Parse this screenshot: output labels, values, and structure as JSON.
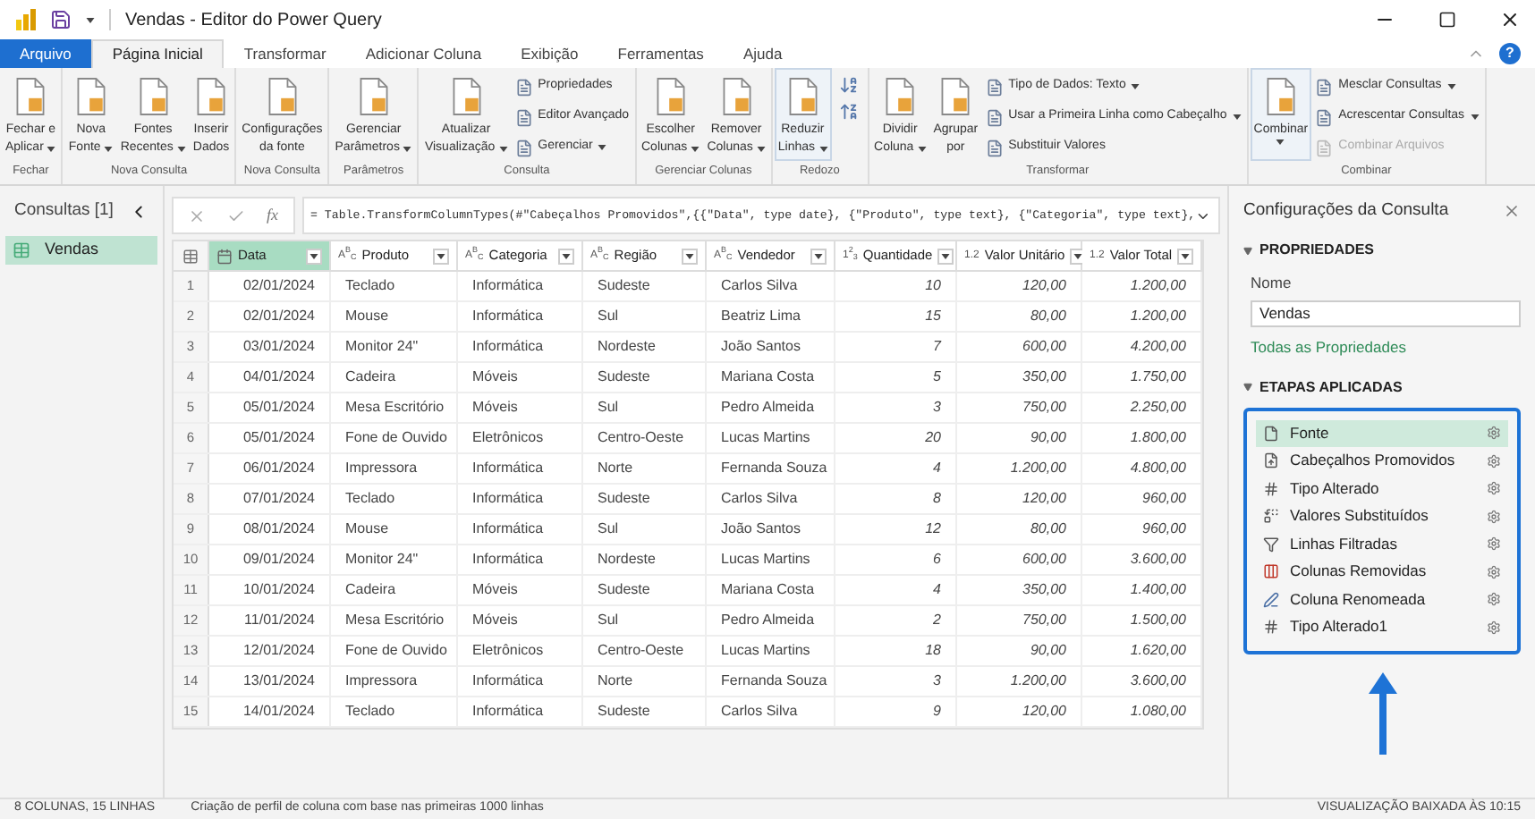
{
  "window": {
    "title": "Vendas - Editor do Power Query",
    "help": "?"
  },
  "tabs": [
    {
      "label": "Arquivo",
      "kind": "file",
      "selected": false
    },
    {
      "label": "Página Inicial",
      "kind": "tab",
      "selected": true
    },
    {
      "label": "Transformar",
      "kind": "tab",
      "selected": false
    },
    {
      "label": "Adicionar Coluna",
      "kind": "tab",
      "selected": false
    },
    {
      "label": "Exibição",
      "kind": "tab",
      "selected": false
    },
    {
      "label": "Ferramentas",
      "kind": "tab",
      "selected": false
    },
    {
      "label": "Ajuda",
      "kind": "tab",
      "selected": false
    }
  ],
  "ribbon": [
    {
      "label": "Fechar",
      "items": [
        {
          "kind": "large",
          "lines": [
            "Fechar e",
            "Aplicar"
          ],
          "dropdown": true,
          "outlined": false
        }
      ]
    },
    {
      "label": "Nova Consulta",
      "items": [
        {
          "kind": "large",
          "lines": [
            "Nova",
            "Fonte"
          ],
          "dropdown": true,
          "outlined": false
        },
        {
          "kind": "large",
          "lines": [
            "Fontes",
            "Recentes"
          ],
          "dropdown": true,
          "outlined": false
        },
        {
          "kind": "large",
          "lines": [
            "Inserir",
            "Dados"
          ],
          "dropdown": false,
          "outlined": false
        }
      ]
    },
    {
      "label": "Nova Consulta",
      "items": [
        {
          "kind": "large",
          "lines": [
            "Configurações",
            "da fonte"
          ],
          "dropdown": false,
          "outlined": false
        }
      ]
    },
    {
      "label": "Parâmetros",
      "items": [
        {
          "kind": "large",
          "lines": [
            "Gerenciar",
            "Parâmetros"
          ],
          "dropdown": true,
          "outlined": false
        }
      ]
    },
    {
      "label": "Consulta",
      "items": [
        {
          "kind": "large",
          "lines": [
            "Atualizar",
            "Visualização"
          ],
          "dropdown": true,
          "outlined": false
        },
        {
          "kind": "stack",
          "entries": [
            {
              "label": "Propriedades",
              "dropdown": false,
              "disabled": false
            },
            {
              "label": "Editor Avançado",
              "dropdown": false,
              "disabled": false
            },
            {
              "label": "Gerenciar",
              "dropdown": true,
              "disabled": false
            }
          ]
        }
      ]
    },
    {
      "label": "Gerenciar Colunas",
      "items": [
        {
          "kind": "large",
          "lines": [
            "Escolher",
            "Colunas"
          ],
          "dropdown": true,
          "outlined": false
        },
        {
          "kind": "large",
          "lines": [
            "Remover",
            "Colunas"
          ],
          "dropdown": true,
          "outlined": false
        }
      ]
    },
    {
      "label": "Redozo",
      "items": [
        {
          "kind": "large",
          "lines": [
            "Reduzir",
            "Linhas"
          ],
          "dropdown": true,
          "outlined": true
        },
        {
          "kind": "sort"
        }
      ]
    },
    {
      "label": "Transformar",
      "items": [
        {
          "kind": "large",
          "lines": [
            "Dividir",
            "Coluna"
          ],
          "dropdown": true,
          "outlined": false
        },
        {
          "kind": "large",
          "lines": [
            "Agrupar",
            "por"
          ],
          "dropdown": false,
          "outlined": false
        },
        {
          "kind": "stack",
          "entries": [
            {
              "label": "Tipo de Dados: Texto",
              "dropdown": true,
              "disabled": false
            },
            {
              "label": "Usar a Primeira Linha como Cabeçalho",
              "dropdown": true,
              "disabled": false
            },
            {
              "label": "Substituir Valores",
              "dropdown": false,
              "disabled": false
            }
          ]
        }
      ]
    },
    {
      "label": "Combinar",
      "items": [
        {
          "kind": "large",
          "lines": [
            "Combinar"
          ],
          "dropdown": true,
          "outlined": true
        },
        {
          "kind": "stack",
          "entries": [
            {
              "label": "Mesclar Consultas",
              "dropdown": true,
              "disabled": false
            },
            {
              "label": "Acrescentar Consultas",
              "dropdown": true,
              "disabled": false
            },
            {
              "label": "Combinar Arquivos",
              "dropdown": false,
              "disabled": true
            }
          ]
        }
      ]
    }
  ],
  "queries": {
    "title": "Consultas [1]",
    "items": [
      {
        "label": "Vendas",
        "selected": true
      }
    ]
  },
  "formula": "= Table.TransformColumnTypes(#\"Cabeçalhos Promovidos\",{{\"Data\", type date}, {\"Produto\", type text}, {\"Categoria\", type text},",
  "fx": "fx",
  "table": {
    "columns": [
      {
        "name": "Data",
        "kind": "date",
        "selected": true
      },
      {
        "name": "Produto",
        "kind": "text",
        "glyph": "A$^{B}$$_{C}$",
        "selected": false
      },
      {
        "name": "Categoria",
        "kind": "text",
        "glyph": "A$^{B}$$_{C}$",
        "selected": false
      },
      {
        "name": "Região",
        "kind": "text",
        "glyph": "A$^{B}$$_{C}$",
        "selected": false
      },
      {
        "name": "Vendedor",
        "kind": "text",
        "glyph": "A$^{B}$$_{C}$",
        "selected": false
      },
      {
        "name": "Quantidade",
        "kind": "number",
        "glyph": "1$^{2}$$_{3}$",
        "selected": false
      },
      {
        "name": "Valor Unitário",
        "kind": "number",
        "glyph": "1.2",
        "selected": false
      },
      {
        "name": "Valor Total",
        "kind": "number",
        "glyph": "1.2",
        "selected": false
      }
    ],
    "rows": [
      {
        "number": "1",
        "cells": [
          "02/01/2024",
          "Teclado",
          "Informática",
          "Sudeste",
          "Carlos Silva",
          "10",
          "120,00",
          "1.200,00"
        ]
      },
      {
        "number": "2",
        "cells": [
          "02/01/2024",
          "Mouse",
          "Informática",
          "Sul",
          "Beatriz Lima",
          "15",
          "80,00",
          "1.200,00"
        ]
      },
      {
        "number": "3",
        "cells": [
          "03/01/2024",
          "Monitor 24\"",
          "Informática",
          "Nordeste",
          "João Santos",
          "7",
          "600,00",
          "4.200,00"
        ]
      },
      {
        "number": "4",
        "cells": [
          "04/01/2024",
          "Cadeira",
          "Móveis",
          "Sudeste",
          "Mariana Costa",
          "5",
          "350,00",
          "1.750,00"
        ]
      },
      {
        "number": "5",
        "cells": [
          "05/01/2024",
          "Mesa Escritório",
          "Móveis",
          "Sul",
          "Pedro Almeida",
          "3",
          "750,00",
          "2.250,00"
        ]
      },
      {
        "number": "6",
        "cells": [
          "05/01/2024",
          "Fone de Ouvido",
          "Eletrônicos",
          "Centro-Oeste",
          "Lucas Martins",
          "20",
          "90,00",
          "1.800,00"
        ]
      },
      {
        "number": "7",
        "cells": [
          "06/01/2024",
          "Impressora",
          "Informática",
          "Norte",
          "Fernanda Souza",
          "4",
          "1.200,00",
          "4.800,00"
        ]
      },
      {
        "number": "8",
        "cells": [
          "07/01/2024",
          "Teclado",
          "Informática",
          "Sudeste",
          "Carlos Silva",
          "8",
          "120,00",
          "960,00"
        ]
      },
      {
        "number": "9",
        "cells": [
          "08/01/2024",
          "Mouse",
          "Informática",
          "Sul",
          "João Santos",
          "12",
          "80,00",
          "960,00"
        ]
      },
      {
        "number": "10",
        "cells": [
          "09/01/2024",
          "Monitor 24\"",
          "Informática",
          "Nordeste",
          "Lucas Martins",
          "6",
          "600,00",
          "3.600,00"
        ]
      },
      {
        "number": "11",
        "cells": [
          "10/01/2024",
          "Cadeira",
          "Móveis",
          "Sudeste",
          "Mariana Costa",
          "4",
          "350,00",
          "1.400,00"
        ]
      },
      {
        "number": "12",
        "cells": [
          "11/01/2024",
          "Mesa Escritório",
          "Móveis",
          "Sul",
          "Pedro Almeida",
          "2",
          "750,00",
          "1.500,00"
        ]
      },
      {
        "number": "13",
        "cells": [
          "12/01/2024",
          "Fone de Ouvido",
          "Eletrônicos",
          "Centro-Oeste",
          "Lucas Martins",
          "18",
          "90,00",
          "1.620,00"
        ]
      },
      {
        "number": "14",
        "cells": [
          "13/01/2024",
          "Impressora",
          "Informática",
          "Norte",
          "Fernanda Souza",
          "3",
          "1.200,00",
          "3.600,00"
        ]
      },
      {
        "number": "15",
        "cells": [
          "14/01/2024",
          "Teclado",
          "Informática",
          "Sudeste",
          "Carlos Silva",
          "9",
          "120,00",
          "1.080,00"
        ]
      }
    ]
  },
  "settings": {
    "title": "Configurações da Consulta",
    "properties_heading": "PROPRIEDADES",
    "name_label": "Nome",
    "name_value": "Vendas",
    "all_properties": "Todas as Propriedades",
    "steps_heading": "ETAPAS APLICADAS",
    "steps": [
      {
        "label": "Fonte",
        "kind": "source",
        "selected": true
      },
      {
        "label": "Cabeçalhos Promovidos",
        "kind": "promote",
        "selected": false
      },
      {
        "label": "Tipo Alterado",
        "kind": "type",
        "selected": false
      },
      {
        "label": "Valores Substituídos",
        "kind": "replace",
        "selected": false
      },
      {
        "label": "Linhas Filtradas",
        "kind": "filter",
        "selected": false
      },
      {
        "label": "Colunas Removidas",
        "kind": "remove",
        "selected": false
      },
      {
        "label": "Coluna Renomeada",
        "kind": "rename",
        "selected": false
      },
      {
        "label": "Tipo Alterado1",
        "kind": "type",
        "selected": false
      }
    ]
  },
  "status_bar": {
    "counts": "8 COLUNAS, 15 LINHAS",
    "profiling": "Criação de perfil de coluna com base nas primeiras 1000 linhas",
    "preview": "VISUALIZAÇÃO BAIXADA ÀS 10:15"
  }
}
